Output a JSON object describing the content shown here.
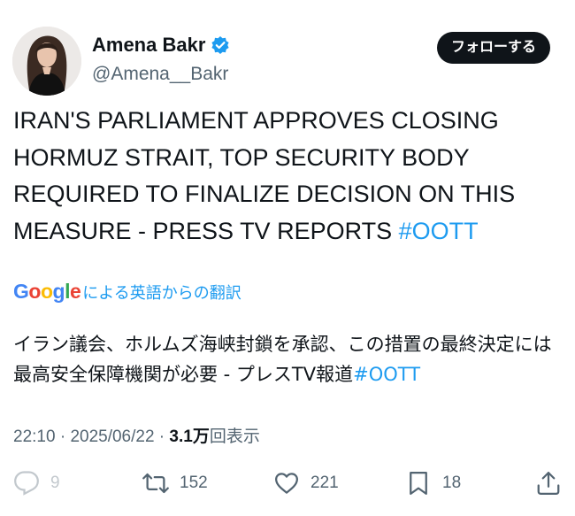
{
  "author": {
    "display_name": "Amena Bakr",
    "handle": "@Amena__Bakr",
    "verified_icon": "verified-badge-icon",
    "avatar": "profile-photo"
  },
  "follow_button": {
    "label": "フォローする"
  },
  "tweet": {
    "text": "IRAN'S PARLIAMENT APPROVES CLOSING HORMUZ STRAIT, TOP SECURITY BODY REQUIRED TO FINALIZE DECISION ON THIS MEASURE - PRESS TV REPORTS ",
    "hashtag": "#OOTT"
  },
  "translation": {
    "provider": "Google",
    "label": "による英語からの翻訳",
    "text": "イラン議会、ホルムズ海峡封鎖を承認、この措置の最終決定には最高安全保障機関が必要 - プレスTV報道",
    "hashtag": "#OOTT"
  },
  "meta": {
    "time": "22:10",
    "separator": " · ",
    "date": "2025/06/22",
    "views_count": "3.1万",
    "views_label": "回表示"
  },
  "actions": {
    "replies": "9",
    "reposts": "152",
    "likes": "221",
    "bookmarks": "18"
  },
  "colors": {
    "accent": "#1d9bf0",
    "text": "#0f1419",
    "muted": "#536471"
  }
}
